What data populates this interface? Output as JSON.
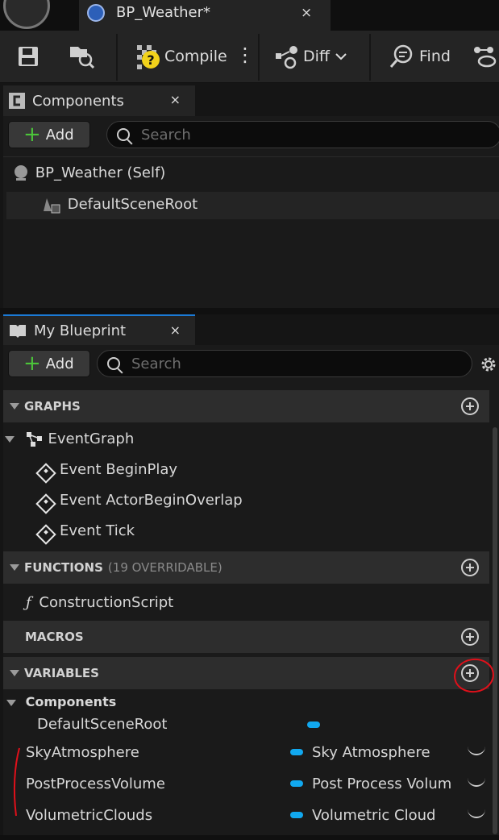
{
  "tabbar": {
    "doc_title": "BP_Weather*",
    "close": "×"
  },
  "toolbar": {
    "compile": "Compile",
    "diff": "Diff",
    "find": "Find",
    "more": "⋮"
  },
  "components": {
    "tab_label": "Components",
    "close": "×",
    "add_label": "Add",
    "search_placeholder": "Search",
    "tree": [
      "BP_Weather (Self)",
      "DefaultSceneRoot"
    ]
  },
  "myblueprint": {
    "tab_label": "My Blueprint",
    "close": "×",
    "add_label": "Add",
    "search_placeholder": "Search",
    "sections": {
      "graphs": "GRAPHS",
      "functions": "FUNCTIONS",
      "functions_sub": "(19 OVERRIDABLE)",
      "macros": "MACROS",
      "variables": "VARIABLES"
    },
    "graphs": {
      "name": "EventGraph",
      "events": [
        "Event BeginPlay",
        "Event ActorBeginOverlap",
        "Event Tick"
      ]
    },
    "functions": [
      "ConstructionScript"
    ],
    "variables": {
      "category": "Components",
      "items": [
        {
          "name": "DefaultSceneRoot",
          "type": ""
        },
        {
          "name": "SkyAtmosphere",
          "type": "Sky Atmosphere"
        },
        {
          "name": "PostProcessVolume",
          "type": "Post Process Volum"
        },
        {
          "name": "VolumetricClouds",
          "type": "Volumetric Cloud"
        }
      ]
    }
  },
  "colors": {
    "accent_blue": "#11a8ef",
    "add_green": "#4cc43a",
    "annotation_red": "#e0101a"
  },
  "icons": [
    "save-icon",
    "browse-icon",
    "compile-status-icon",
    "diff-icon",
    "find-icon",
    "settings-gear-icon",
    "event-icon",
    "function-icon"
  ]
}
